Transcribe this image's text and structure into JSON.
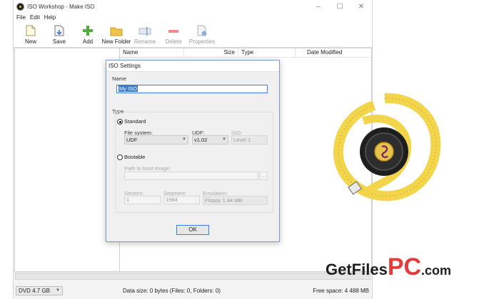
{
  "window": {
    "title": "ISO Workshop - Make ISO",
    "controls": [
      "–",
      "☐",
      "✕"
    ]
  },
  "menu": [
    "File",
    "Edit",
    "Help"
  ],
  "toolbar": {
    "new": "New",
    "save": "Save",
    "add": "Add",
    "new_folder": "New Folder",
    "rename": "Rename",
    "delete": "Delete",
    "properties": "Properties"
  },
  "columns": {
    "name": "Name",
    "size": "Size",
    "type": "Type",
    "date": "Date Modified"
  },
  "dialog": {
    "title": "ISO Settings",
    "name_section": "Name",
    "name_value": "My ISO",
    "type_section": "Type",
    "standard_label": "Standard",
    "standard_selected": true,
    "filesystem_label": "File system:",
    "filesystem_value": "UDF",
    "udf_label": "UDF:",
    "udf_value": "v1.02",
    "iso_label": "ISO:",
    "iso_value": "Level 1",
    "bootable_label": "Bootable",
    "bootable_selected": false,
    "boot_path_label": "Path to boot image:",
    "boot_path_value": "",
    "browse_label": "...",
    "sectors_label": "Sectors:",
    "sectors_value": "1",
    "segment_label": "Segment:",
    "segment_value": "1984",
    "emulation_label": "Emulation:",
    "emulation_value": "Floppy 1.44 MB",
    "ok_label": "OK"
  },
  "status": {
    "media": "DVD 4.7 GB",
    "data_size": "Data size: 0 bytes (Files: 0, Folders: 0)",
    "free_space": "Free space: 4 488 MB"
  },
  "watermark": {
    "part1": "GetFiles",
    "part2": "PC",
    "part3": ".com"
  },
  "colors": {
    "accent": "#3c7fd6",
    "selection": "#3a78d4",
    "brand_red": "#e43b3b",
    "tape_yellow": "#f2d54b"
  }
}
